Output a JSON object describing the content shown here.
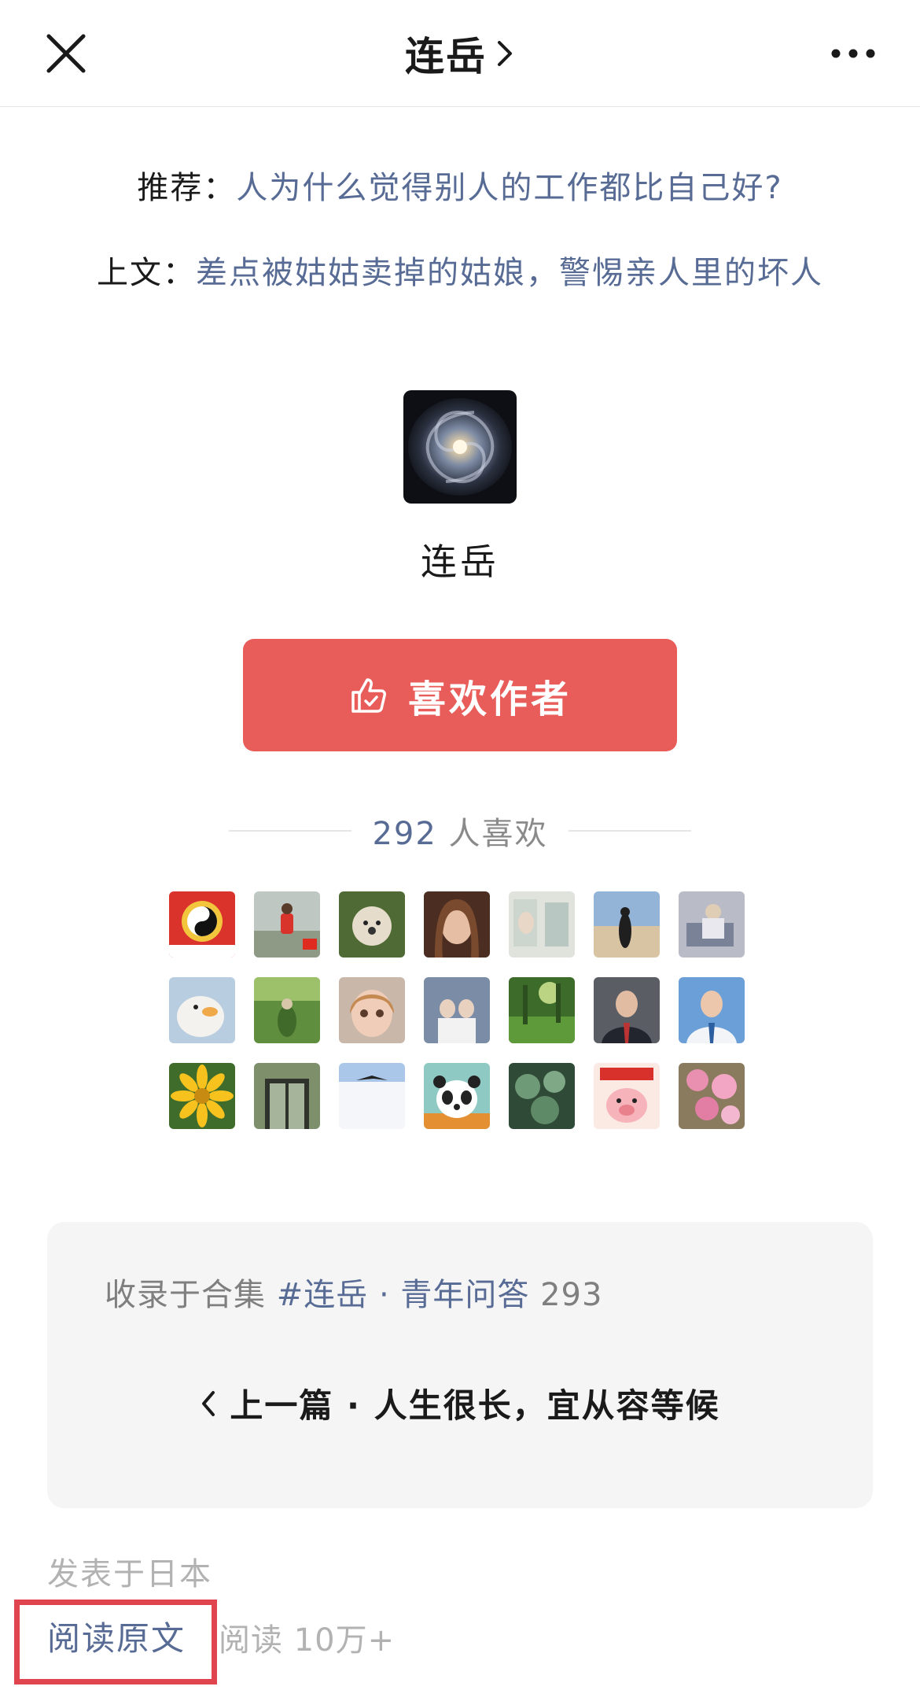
{
  "header": {
    "title": "连岳",
    "close_icon": "close-icon",
    "more_icon": "more-icon"
  },
  "recommend": {
    "label": "推荐：",
    "link": "人为什么觉得别人的工作都比自己好?"
  },
  "previous_text": {
    "label": "上文：",
    "link": "差点被姑姑卖掉的姑娘，警惕亲人里的坏人"
  },
  "author": {
    "name": "连岳",
    "avatar_icon": "galaxy-avatar"
  },
  "like_button": {
    "label": "喜欢作者",
    "icon": "thumbs-up-icon",
    "color": "#e85d5a"
  },
  "likes": {
    "count": "292",
    "suffix": "人喜欢"
  },
  "collection": {
    "prefix": "收录于合集",
    "tag": "#连岳 · 青年问答",
    "count": "293",
    "prev_article": "上一篇 · 人生很长，宜从容等候"
  },
  "footer": {
    "published": "发表于日本",
    "read_original": "阅读原文",
    "read_count": "阅读 10万+"
  },
  "colors": {
    "link": "#576b95",
    "accent": "#e85d5a",
    "highlight_box": "#e0454f"
  }
}
